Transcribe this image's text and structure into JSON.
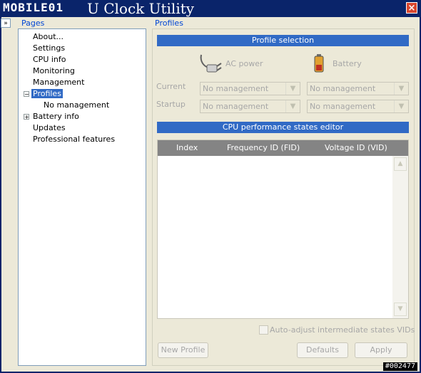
{
  "window": {
    "logo_text": "MOBILE01",
    "title": "U Clock Utility",
    "close_glyph": "×"
  },
  "collapse_glyph": "»",
  "pages": {
    "group_label": "Pages",
    "items": [
      {
        "label": "About..."
      },
      {
        "label": "Settings"
      },
      {
        "label": "CPU info"
      },
      {
        "label": "Monitoring"
      },
      {
        "label": "Management"
      },
      {
        "label": "Profiles",
        "selected": true,
        "expander": "−"
      },
      {
        "label": "No management"
      },
      {
        "label": "Battery info",
        "expander": "+"
      },
      {
        "label": "Updates"
      },
      {
        "label": "Professional features"
      }
    ]
  },
  "profiles": {
    "group_label": "Profiles",
    "selection_header": "Profile selection",
    "ac_power_label": "AC power",
    "battery_label": "Battery",
    "current_label": "Current",
    "startup_label": "Startup",
    "current_ac": "No management",
    "current_battery": "No management",
    "startup_ac": "No management",
    "startup_battery": "No management",
    "editor_header": "CPU performance states editor",
    "columns": [
      "Index",
      "Frequency ID (FID)",
      "Voltage ID (VID)"
    ],
    "auto_adjust_label": "Auto-adjust intermediate states VIDs",
    "auto_adjust_checked": false,
    "buttons": {
      "new_profile": "New Profile",
      "defaults": "Defaults",
      "apply": "Apply"
    }
  },
  "icons": {
    "ac_power": "power-plug-icon",
    "battery": "battery-icon",
    "dropdown": "chevron-down-icon"
  },
  "watermark": "#002477",
  "colors": {
    "title_bar": "#0a246a",
    "section_bar": "#316ac5",
    "group_label": "#0046d5",
    "grid_header": "#848484",
    "disabled_text": "#a7a7a7"
  }
}
